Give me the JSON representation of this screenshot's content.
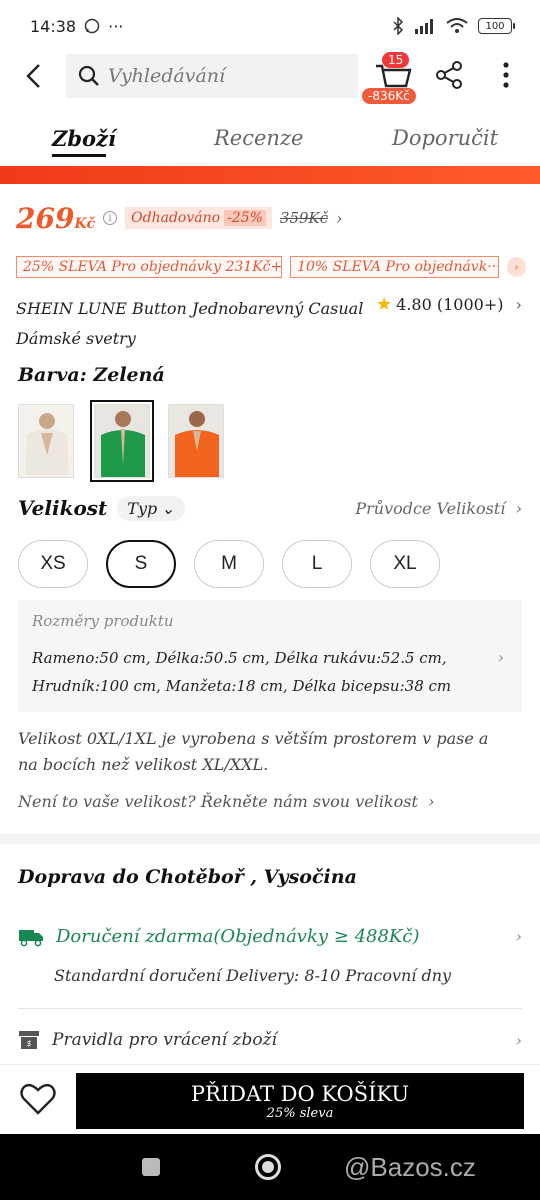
{
  "status_bar": {
    "time": "14:38",
    "battery": "100"
  },
  "search": {
    "placeholder": "Vyhledávání"
  },
  "cart": {
    "count": "15",
    "price": "-836Kč"
  },
  "tabs": [
    {
      "label": "Zboží",
      "active": true
    },
    {
      "label": "Recenze",
      "active": false
    },
    {
      "label": "Doporučit",
      "active": false
    }
  ],
  "price": {
    "current": "269",
    "currency": "Kč",
    "estimated_label": "Odhadováno",
    "discount": "-25%",
    "old": "359Kč"
  },
  "coupons": [
    "25% SLEVA Pro objednávky 231Kč+",
    "10% SLEVA Pro objednávk···"
  ],
  "product": {
    "title": "SHEIN LUNE Button Jednobarevný Casual Dámské svetry",
    "rating": "4.80 (1000+)"
  },
  "color": {
    "label": "Barva: Zelená",
    "swatches": [
      {
        "name": "white",
        "color": "#ece7df"
      },
      {
        "name": "green",
        "color": "#1f9a4a"
      },
      {
        "name": "orange",
        "color": "#f2641e"
      }
    ],
    "selected": 1
  },
  "size": {
    "label": "Velikost",
    "type": "Typ",
    "guide": "Průvodce Velikostí",
    "options": [
      "XS",
      "S",
      "M",
      "L",
      "XL"
    ],
    "selected": "S"
  },
  "dimensions": {
    "title": "Rozměry produktu",
    "line1": "Rameno:50 cm, Délka:50.5 cm, Délka rukávu:52.5 cm,",
    "line2": "Hrudník:100 cm, Manžeta:18 cm, Délka bicepsu:38 cm"
  },
  "note": "Velikost 0XL/1XL je vyrobena s větším prostorem v pase a na bocích než velikost XL/XXL.",
  "fit_link": "Není to vaše velikost? Řekněte nám svou velikost",
  "shipping": {
    "title": "Doprava do Chotěboř , Vysočina",
    "free": "Doručení zdarma(Objednávky ≥ 488Kč)",
    "standard": "Standardní doručení Delivery: 8-10 Pracovní dny",
    "returns": "Pravidla pro vrácení zboží"
  },
  "bottom": {
    "add_label": "PŘIDAT DO KOŠÍKU",
    "add_sub": "25% sleva"
  },
  "watermark": "@Bazos.cz",
  "colors": {
    "accent": "#f05a2a",
    "free_ship": "#198754",
    "button": "#000000"
  }
}
